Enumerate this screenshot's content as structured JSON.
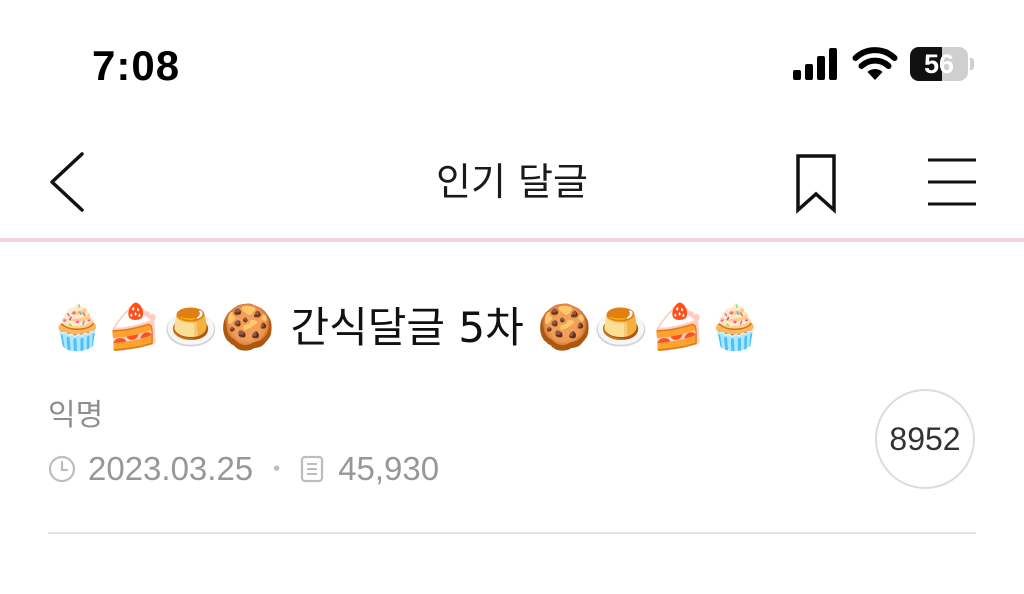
{
  "status_bar": {
    "time": "7:08",
    "battery_level": "56",
    "battery_fraction": 0.56,
    "icons": [
      "signal-icon",
      "wifi-icon",
      "battery-icon"
    ]
  },
  "nav": {
    "title": "인기 달글",
    "icons": [
      "back-chevron-icon",
      "bookmark-icon",
      "hamburger-menu-icon"
    ]
  },
  "post": {
    "title_emoji_left": "🧁🍰🍮🍪",
    "title_text": "간식달글 5차",
    "title_emoji_right": "🍪🍮🍰🧁",
    "author": "익명",
    "date": "2023.03.25",
    "views": "45,930",
    "comment_count": "8952",
    "meta_icons": [
      "clock-icon",
      "document-icon"
    ]
  },
  "colors": {
    "accent_divider": "#f7d3db",
    "meta_text": "#979797",
    "divider": "#e2e2e2"
  }
}
